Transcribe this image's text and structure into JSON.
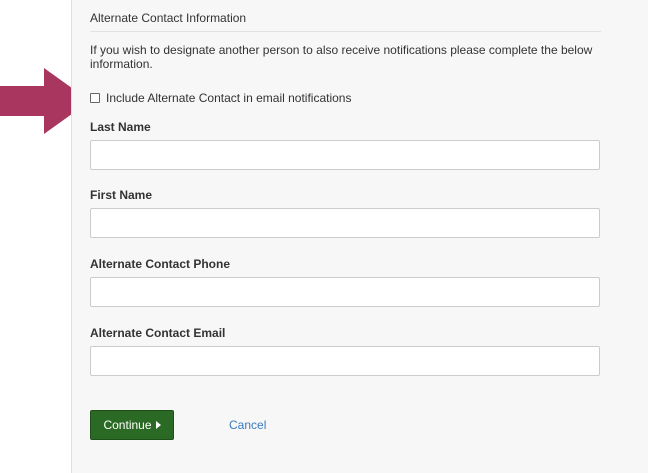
{
  "section": {
    "title": "Alternate Contact Information",
    "intro": "If you wish to designate another person to also receive notifications please complete the below information."
  },
  "checkbox": {
    "label": "Include Alternate Contact in email notifications",
    "checked": false
  },
  "fields": [
    {
      "label": "Last Name",
      "value": ""
    },
    {
      "label": "First Name",
      "value": ""
    },
    {
      "label": "Alternate Contact Phone",
      "value": ""
    },
    {
      "label": "Alternate Contact Email",
      "value": ""
    }
  ],
  "actions": {
    "continue_label": "Continue",
    "cancel_label": "Cancel"
  },
  "colors": {
    "arrow": "#a9365f",
    "continue_bg": "#2b6a24",
    "link": "#3a7bbf"
  },
  "icons": {
    "arrow": "arrow-right-icon",
    "continue": "caret-right-icon"
  }
}
